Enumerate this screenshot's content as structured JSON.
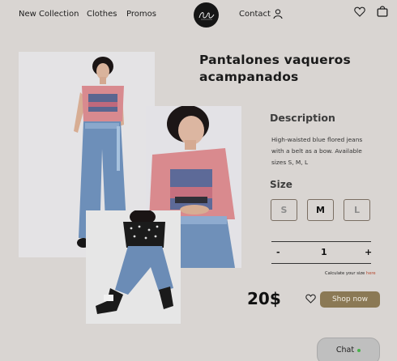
{
  "header": {
    "nav": [
      "New Collection",
      "Clothes",
      "Promos"
    ],
    "contact": "Contact",
    "logo_text": "Shiny"
  },
  "product": {
    "title": "Pantalones vaqueros acampanados",
    "description_heading": "Description",
    "description": "High-waisted blue flored jeans with a belt as a bow. Available sizes S, M, L",
    "size_heading": "Size",
    "sizes": [
      "S",
      "M",
      "L"
    ],
    "selected_size": "M",
    "quantity": "1",
    "qty_minus": "-",
    "qty_plus": "+",
    "calc_size_text": "Calculate your size",
    "calc_size_link": "here",
    "price": "20$",
    "shop_button": "Shop now"
  },
  "chat": {
    "label": "Chat",
    "status_color": "#48b24a"
  },
  "colors": {
    "background": "#d9d5d2",
    "accent": "#8b7955",
    "link": "#b4492e"
  },
  "icons": [
    "logo-icon",
    "user-icon",
    "heart-icon",
    "shopping-bag-icon",
    "heart-icon"
  ]
}
